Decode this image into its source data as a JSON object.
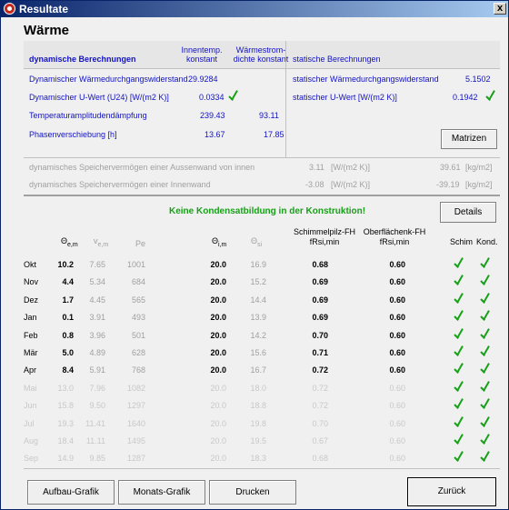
{
  "window": {
    "title": "Resultate",
    "close_label": "x"
  },
  "heading": "Wärme",
  "dynamic": {
    "section_label": "dynamische Berechnungen",
    "col_innentemp": [
      "Innentemp.",
      "konstant"
    ],
    "col_waermestrom": [
      "Wärmestrom-",
      "dichte konstant"
    ],
    "rows": [
      {
        "label": "Dynamischer Wärmedurchgangswiderstand",
        "v1": "29.9284",
        "v2": ""
      },
      {
        "label": "Dynamischer U-Wert (U24) [W/(m2 K)]",
        "v1": "0.0334",
        "v2": "",
        "check": true
      },
      {
        "label": "Temperaturamplitudendämpfung",
        "v1": "239.43",
        "v2": "93.11"
      },
      {
        "label": "Phasenverschiebung [h]",
        "v1": "13.67",
        "v2": "17.85"
      }
    ]
  },
  "static": {
    "section_label": "statische Berechnungen",
    "rows": [
      {
        "label": "statischer Wärmedurchgangswiderstand",
        "value": "5.1502"
      },
      {
        "label": "statischer U-Wert [W/(m2 K)]",
        "value": "0.1942",
        "check": true
      }
    ],
    "matrix_button": "Matrizen"
  },
  "storage": [
    {
      "label": "dynamisches Speichervermögen einer Aussenwand von innen",
      "v1": "3.11",
      "u1": "[W/(m2 K)]",
      "v2": "39.61",
      "u2": "[kg/m2]"
    },
    {
      "label": "dynamisches Speichervermögen einer Innenwand",
      "v1": "-3.08",
      "u1": "[W/(m2 K)]",
      "v2": "-39.19",
      "u2": "[kg/m2]"
    }
  ],
  "condensation_message": "Keine Kondensatbildung in der Konstruktion!",
  "details_button": "Details",
  "table": {
    "headers": {
      "theta_em": "Θ",
      "theta_em_sub": "e,m",
      "v_em": "v",
      "v_em_sub": "e,m",
      "pe": "Pe",
      "theta_im": "Θ",
      "theta_im_sub": "i,m",
      "theta_si": "Θ",
      "theta_si_sub": "si",
      "schimmel": [
        "Schimmelpilz-FH",
        "fRsi,min"
      ],
      "oberflaeche": [
        "Oberflächenk-FH",
        "fRsi,min"
      ],
      "schim": "Schim",
      "kond": "Kond."
    },
    "rows": [
      {
        "month": "Okt",
        "te": "10.2",
        "ve": "7.65",
        "pe": "1001",
        "ti": "20.0",
        "tsi": "16.9",
        "fs": "0.68",
        "fo": "0.60",
        "active": true
      },
      {
        "month": "Nov",
        "te": "4.4",
        "ve": "5.34",
        "pe": "684",
        "ti": "20.0",
        "tsi": "15.2",
        "fs": "0.69",
        "fo": "0.60",
        "active": true
      },
      {
        "month": "Dez",
        "te": "1.7",
        "ve": "4.45",
        "pe": "565",
        "ti": "20.0",
        "tsi": "14.4",
        "fs": "0.69",
        "fo": "0.60",
        "active": true
      },
      {
        "month": "Jan",
        "te": "0.1",
        "ve": "3.91",
        "pe": "493",
        "ti": "20.0",
        "tsi": "13.9",
        "fs": "0.69",
        "fo": "0.60",
        "active": true
      },
      {
        "month": "Feb",
        "te": "0.8",
        "ve": "3.96",
        "pe": "501",
        "ti": "20.0",
        "tsi": "14.2",
        "fs": "0.70",
        "fo": "0.60",
        "active": true
      },
      {
        "month": "Mär",
        "te": "5.0",
        "ve": "4.89",
        "pe": "628",
        "ti": "20.0",
        "tsi": "15.6",
        "fs": "0.71",
        "fo": "0.60",
        "active": true
      },
      {
        "month": "Apr",
        "te": "8.4",
        "ve": "5.91",
        "pe": "768",
        "ti": "20.0",
        "tsi": "16.7",
        "fs": "0.72",
        "fo": "0.60",
        "active": true
      },
      {
        "month": "Mai",
        "te": "13.0",
        "ve": "7.96",
        "pe": "1082",
        "ti": "20.0",
        "tsi": "18.0",
        "fs": "0.72",
        "fo": "0.60",
        "active": false
      },
      {
        "month": "Jun",
        "te": "15.8",
        "ve": "9.50",
        "pe": "1297",
        "ti": "20.0",
        "tsi": "18.8",
        "fs": "0.72",
        "fo": "0.60",
        "active": false
      },
      {
        "month": "Jul",
        "te": "19.3",
        "ve": "11.41",
        "pe": "1640",
        "ti": "20.0",
        "tsi": "19.8",
        "fs": "0.70",
        "fo": "0.60",
        "active": false
      },
      {
        "month": "Aug",
        "te": "18.4",
        "ve": "11.11",
        "pe": "1495",
        "ti": "20.0",
        "tsi": "19.5",
        "fs": "0.67",
        "fo": "0.60",
        "active": false
      },
      {
        "month": "Sep",
        "te": "14.9",
        "ve": "9.85",
        "pe": "1287",
        "ti": "20.0",
        "tsi": "18.3",
        "fs": "0.68",
        "fo": "0.60",
        "active": false
      }
    ]
  },
  "footer": {
    "aufbau": "Aufbau-Grafik",
    "monats": "Monats-Grafik",
    "drucken": "Drucken",
    "zurueck": "Zurück"
  },
  "colors": {
    "check": "#18a018",
    "link_blue": "#1212c4",
    "title_start": "#0a246a"
  }
}
